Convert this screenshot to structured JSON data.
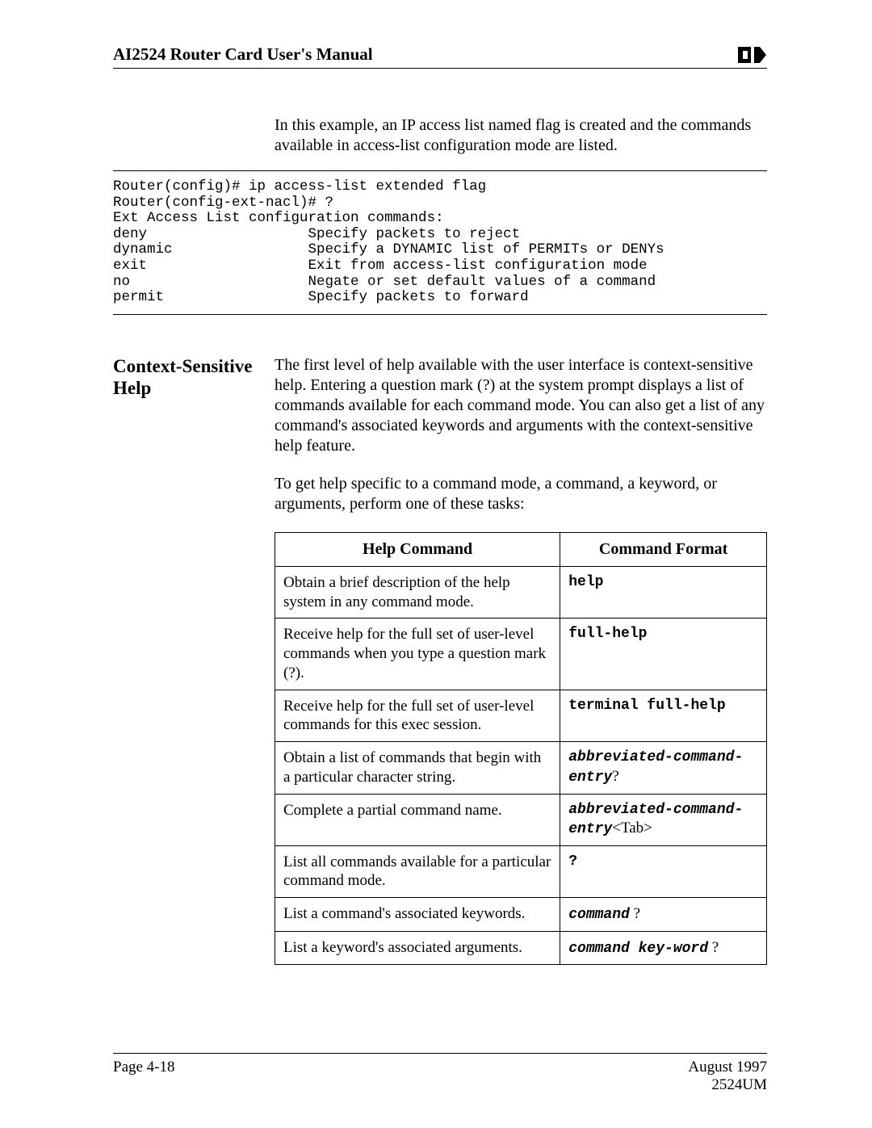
{
  "header": {
    "title": "AI2524 Router Card User's Manual"
  },
  "intro": "In this example, an IP access list named flag is created and the commands available in access-list configuration mode are listed.",
  "code": "Router(config)# ip access-list extended flag\nRouter(config-ext-nacl)# ?\nExt Access List configuration commands:\ndeny                   Specify packets to reject\ndynamic                Specify a DYNAMIC list of PERMITs or DENYs\nexit                   Exit from access-list configuration mode\nno                     Negate or set default values of a command\npermit                 Specify packets to forward",
  "section": {
    "heading": "Context-Sensitive Help",
    "para1": "The first level of help available with the user interface is context-sensitive help. Entering a question mark (?) at the system prompt displays a list of commands available for each command mode. You can also get a list of any command's associated keywords and arguments with the context-sensitive help feature.",
    "para2": "To get help specific to a command mode, a command, a keyword, or arguments, perform one of these tasks:"
  },
  "table": {
    "headers": {
      "col1": "Help Command",
      "col2": "Command Format"
    },
    "rows": [
      {
        "cmd": "Obtain a brief description of the help system in any command mode.",
        "fmt": [
          {
            "t": "mono",
            "text": "help"
          }
        ]
      },
      {
        "cmd": "Receive help for the full set of user-level commands when you type a question mark (?).",
        "fmt": [
          {
            "t": "mono",
            "text": "full-help"
          }
        ]
      },
      {
        "cmd": "Receive help for the full set of user-level commands for this exec session.",
        "fmt": [
          {
            "t": "mono",
            "text": "terminal full-help"
          }
        ]
      },
      {
        "cmd": "Obtain a list of commands that begin with a particular character string.",
        "fmt": [
          {
            "t": "monoital",
            "text": "abbreviated-command-entry"
          },
          {
            "t": "roman",
            "text": "?"
          }
        ]
      },
      {
        "cmd": "Complete a partial command name.",
        "fmt": [
          {
            "t": "monoital",
            "text": "abbreviated-command-entry"
          },
          {
            "t": "roman",
            "text": "<Tab>"
          }
        ]
      },
      {
        "cmd": "List all commands available for a particular command mode.",
        "fmt": [
          {
            "t": "mono",
            "text": "?"
          }
        ]
      },
      {
        "cmd": "List a command's associated keywords.",
        "fmt": [
          {
            "t": "monoital",
            "text": "command"
          },
          {
            "t": "roman",
            "text": " ?"
          }
        ]
      },
      {
        "cmd": "List a keyword's associated arguments.",
        "fmt": [
          {
            "t": "monoital",
            "text": "command key-word"
          },
          {
            "t": "roman",
            "text": " ?"
          }
        ]
      }
    ]
  },
  "footer": {
    "left": "Page 4-18",
    "right1": "August 1997",
    "right2": "2524UM"
  }
}
